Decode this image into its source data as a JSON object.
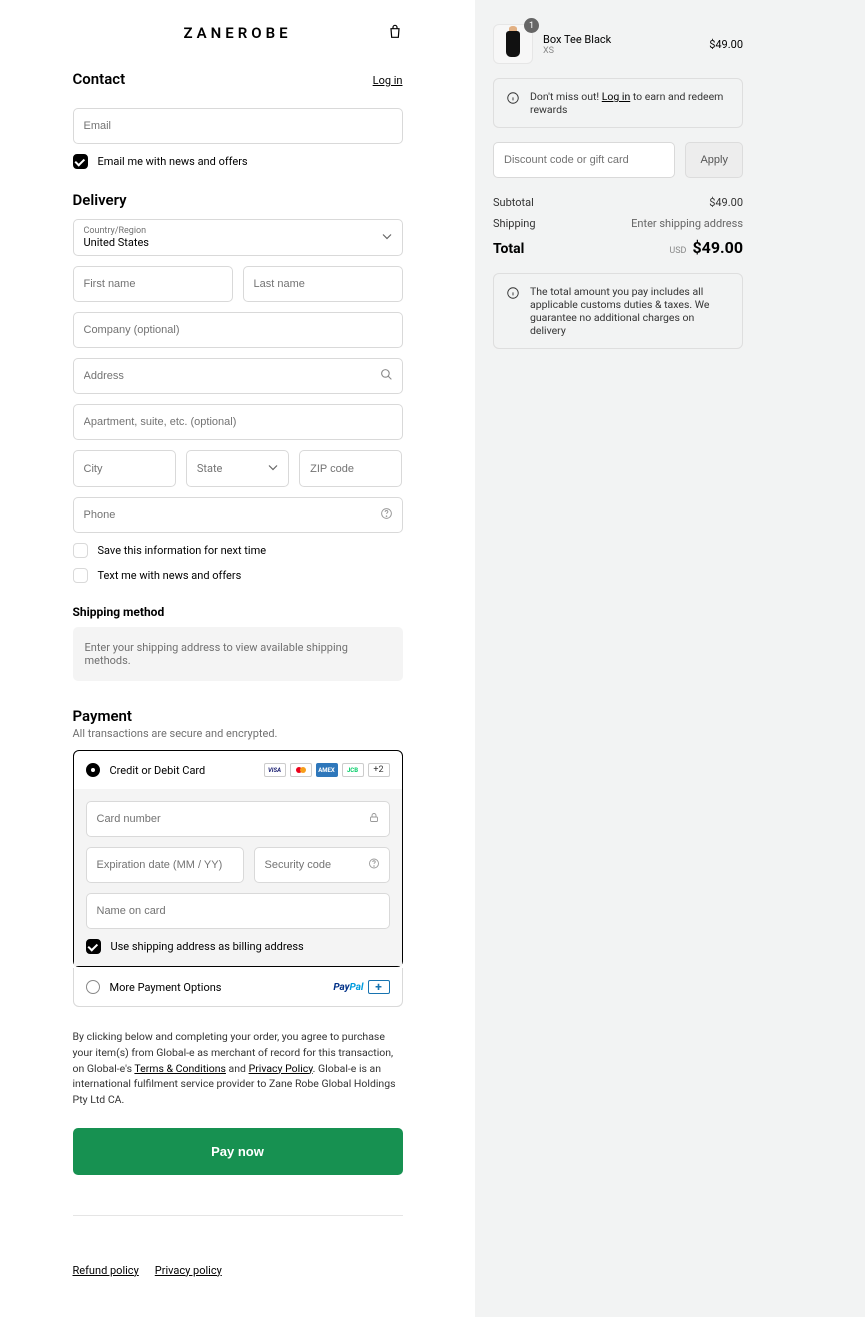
{
  "header": {
    "logo": "ZANEROBE"
  },
  "contact": {
    "title": "Contact",
    "login": "Log in",
    "email_placeholder": "Email",
    "email_news_label": "Email me with news and offers",
    "email_news_checked": true
  },
  "delivery": {
    "title": "Delivery",
    "country_label": "Country/Region",
    "country_value": "United States",
    "first_name_placeholder": "First name",
    "last_name_placeholder": "Last name",
    "company_placeholder": "Company (optional)",
    "address_placeholder": "Address",
    "apt_placeholder": "Apartment, suite, etc. (optional)",
    "city_placeholder": "City",
    "state_placeholder": "State",
    "zip_placeholder": "ZIP code",
    "phone_placeholder": "Phone",
    "save_info_label": "Save this information for next time",
    "text_news_label": "Text me with news and offers"
  },
  "shipping": {
    "title": "Shipping method",
    "note": "Enter your shipping address to view available shipping methods."
  },
  "payment": {
    "title": "Payment",
    "subtitle": "All transactions are secure and encrypted.",
    "credit_label": "Credit or Debit Card",
    "more_count": "+2",
    "card_number_placeholder": "Card number",
    "exp_placeholder": "Expiration date (MM / YY)",
    "cvv_placeholder": "Security code",
    "name_placeholder": "Name on card",
    "use_shipping_label": "Use shipping address as billing address",
    "more_options_label": "More Payment Options"
  },
  "terms": {
    "pre": "By clicking below and completing your order, you agree to purchase your item(s) from Global-e as merchant of record for this transaction, on Global-e's ",
    "terms_link": "Terms & Conditions",
    "and": " and ",
    "privacy_link": "Privacy Policy",
    "post": ". Global-e is an international fulfilment service provider to Zane Robe Global Holdings Pty Ltd CA."
  },
  "pay_button": "Pay now",
  "footer": {
    "refund": "Refund policy",
    "privacy": "Privacy policy"
  },
  "cart": {
    "item": {
      "name": "Box Tee Black",
      "variant": "XS",
      "qty": "1",
      "price": "$49.00"
    },
    "login_pre": "Don't miss out! ",
    "login_link": "Log in",
    "login_post": " to earn and redeem rewards",
    "discount_placeholder": "Discount code or gift card",
    "apply": "Apply",
    "subtotal_label": "Subtotal",
    "subtotal_value": "$49.00",
    "shipping_label": "Shipping",
    "shipping_value": "Enter shipping address",
    "total_label": "Total",
    "currency": "USD",
    "total_value": "$49.00",
    "duties_note": "The total amount you pay includes all applicable customs duties & taxes. We guarantee no additional charges on delivery"
  }
}
